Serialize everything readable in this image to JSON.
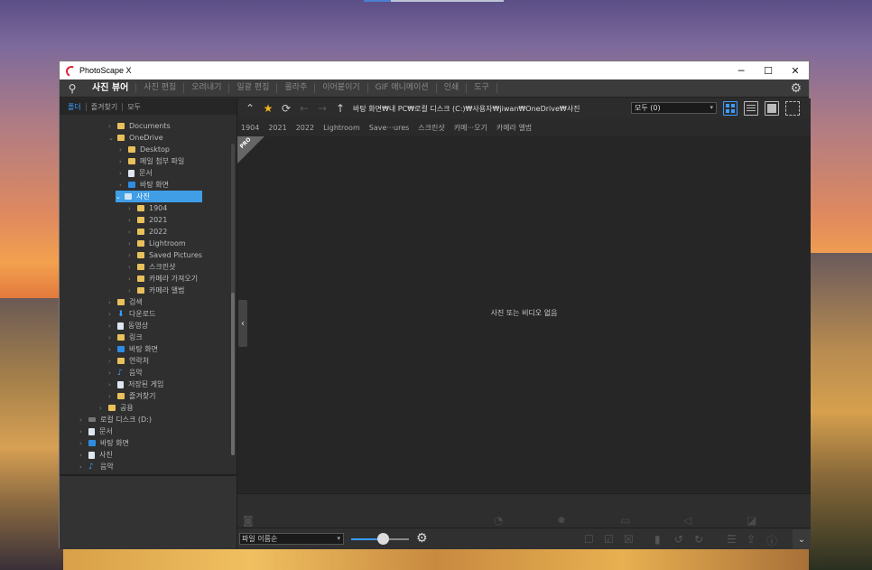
{
  "window": {
    "title": "PhotoScape X",
    "minimize": "─",
    "maximize": "☐",
    "close": "✕"
  },
  "menu": {
    "search_icon": "⚲",
    "items": [
      "사진 뷰어",
      "사진 편집",
      "오려내기",
      "일괄 편집",
      "콜라주",
      "이어붙이기",
      "GIF 애니메이션",
      "인쇄",
      "도구"
    ],
    "settings_icon": "⚙"
  },
  "left_tabs": [
    "폴더",
    "즐겨찾기",
    "모두"
  ],
  "tree": [
    {
      "label": "Documents"
    },
    {
      "label": "OneDrive"
    },
    {
      "label": "Desktop"
    },
    {
      "label": "메일 첨부 파일"
    },
    {
      "label": "문서"
    },
    {
      "label": "바탕 화면"
    },
    {
      "label": "사진"
    },
    {
      "label": "1904"
    },
    {
      "label": "2021"
    },
    {
      "label": "2022"
    },
    {
      "label": "Lightroom"
    },
    {
      "label": "Saved Pictures"
    },
    {
      "label": "스크린샷"
    },
    {
      "label": "카메라 가져오기"
    },
    {
      "label": "카메라 앨범"
    },
    {
      "label": "검색"
    },
    {
      "label": "다운로드"
    },
    {
      "label": "동영상"
    },
    {
      "label": "링크"
    },
    {
      "label": "바탕 화면"
    },
    {
      "label": "연락처"
    },
    {
      "label": "음악"
    },
    {
      "label": "저장된 게임"
    },
    {
      "label": "즐겨찾기"
    },
    {
      "label": "공용"
    },
    {
      "label": "로컬 디스크 (D:)"
    },
    {
      "label": "문서"
    },
    {
      "label": "바탕 화면"
    },
    {
      "label": "사진"
    },
    {
      "label": "음악"
    }
  ],
  "toolbar": {
    "path": "바탕 화면₩내 PC₩로컬 디스크 (C:)₩사용자₩jiwan₩OneDrive₩사진",
    "filter": "모두 (0)"
  },
  "quicklinks": [
    "1904",
    "2021",
    "2022",
    "Lightroom",
    "Save···ures",
    "스크린샷",
    "카메···오기",
    "카메라 앨범"
  ],
  "content": {
    "empty_message": "사진 또는 비디오 없음",
    "pro_badge": "PRO"
  },
  "bottom": {
    "sort": "파일 이름순",
    "thumbnail_size_fraction": 0.55
  }
}
